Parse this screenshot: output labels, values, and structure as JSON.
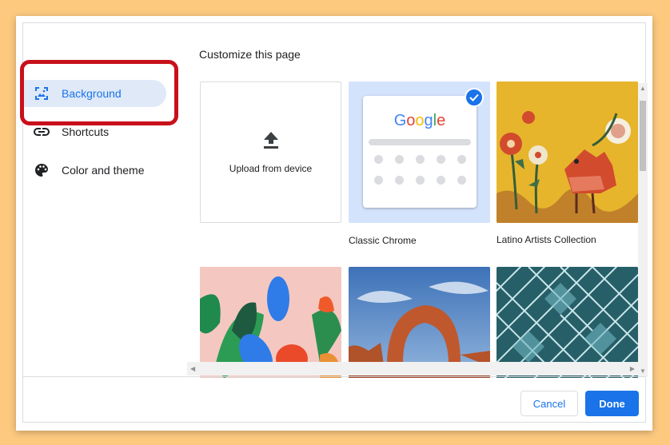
{
  "dialog": {
    "title": "Customize this page"
  },
  "sidebar": {
    "items": [
      {
        "label": "Background",
        "icon": "background-icon",
        "active": true
      },
      {
        "label": "Shortcuts",
        "icon": "link-icon",
        "active": false
      },
      {
        "label": "Color and theme",
        "icon": "palette-icon",
        "active": false
      }
    ]
  },
  "backgrounds": {
    "upload_label": "Upload from device",
    "tiles": [
      {
        "label": "Classic Chrome",
        "selected": true
      },
      {
        "label": "Latino Artists Collection",
        "selected": false
      }
    ],
    "google_word": "Google"
  },
  "footer": {
    "cancel_label": "Cancel",
    "done_label": "Done"
  },
  "colors": {
    "accent": "#1a73e8",
    "page_background": "#fcc97f",
    "highlight": "#c8101b"
  }
}
